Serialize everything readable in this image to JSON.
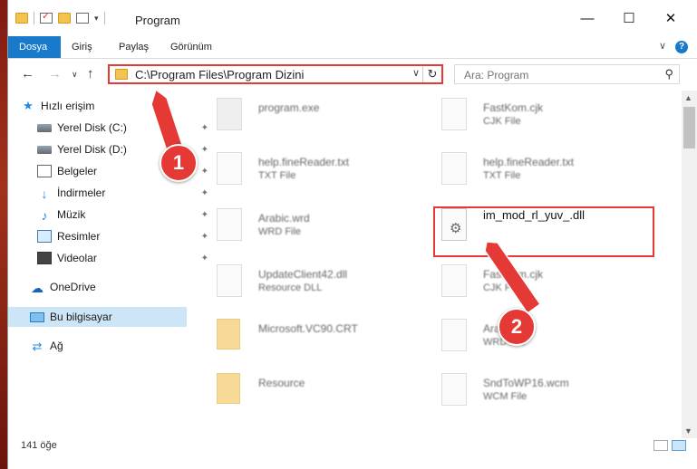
{
  "window": {
    "title": "Program",
    "controls": {
      "minimize": "—",
      "maximize": "☐",
      "close": "✕"
    }
  },
  "ribbon": {
    "tabs": [
      "Dosya",
      "Giriş",
      "Paylaş",
      "Görünüm"
    ],
    "expand": "∨",
    "help": "?"
  },
  "nav": {
    "back": "←",
    "forward": "→",
    "dropdown": "∨",
    "up": "↑",
    "address": "C:\\Program Files\\Program Dizini",
    "address_dropdown": "∨",
    "refresh": "↻",
    "search_placeholder": "Ara: Program",
    "search_icon": "⚲"
  },
  "sidebar": {
    "items": [
      {
        "label": "Hızlı erişim",
        "icon": "star-icon",
        "pinned": false
      },
      {
        "label": "Yerel Disk (C:)",
        "icon": "drive-icon",
        "pinned": true
      },
      {
        "label": "Yerel Disk (D:)",
        "icon": "drive-icon",
        "pinned": true
      },
      {
        "label": "Belgeler",
        "icon": "document-icon",
        "pinned": true
      },
      {
        "label": "İndirmeler",
        "icon": "download-icon",
        "pinned": true
      },
      {
        "label": "Müzik",
        "icon": "music-icon",
        "pinned": true
      },
      {
        "label": "Resimler",
        "icon": "pictures-icon",
        "pinned": true
      },
      {
        "label": "Videolar",
        "icon": "videos-icon",
        "pinned": true
      },
      {
        "label": "OneDrive",
        "icon": "cloud-icon",
        "pinned": false
      },
      {
        "label": "Bu bilgisayar",
        "icon": "computer-icon",
        "pinned": false,
        "selected": true
      },
      {
        "label": "Ağ",
        "icon": "network-icon",
        "pinned": false
      }
    ],
    "pin_glyph": "📌"
  },
  "files": [
    {
      "name": "program.exe",
      "type": "",
      "icon": "exe-icon"
    },
    {
      "name": "FastKom.cjk",
      "type": "CJK File",
      "icon": "file-icon"
    },
    {
      "name": "help.fineReader.txt",
      "type": "TXT File",
      "icon": "file-icon"
    },
    {
      "name": "help.fineReader.txt",
      "type": "TXT File",
      "icon": "file-icon"
    },
    {
      "name": "Arabic.wrd",
      "type": "WRD File",
      "icon": "file-icon"
    },
    {
      "name": "im_mod_rl_yuv_.dll",
      "type": "",
      "icon": "dll-gear-icon",
      "highlighted": true
    },
    {
      "name": "UpdateClient42.dll",
      "type": "Resource DLL",
      "icon": "dll-gear-icon"
    },
    {
      "name": "FastKom.cjk",
      "type": "CJK File",
      "icon": "file-icon"
    },
    {
      "name": "Microsoft.VC90.CRT",
      "type": "",
      "icon": "folder-icon"
    },
    {
      "name": "Arabic.wrd",
      "type": "WRD File",
      "icon": "file-icon"
    },
    {
      "name": "Resource",
      "type": "",
      "icon": "folder-icon"
    },
    {
      "name": "SndToWP16.wcm",
      "type": "WCM File",
      "icon": "file-icon"
    }
  ],
  "status": {
    "count": "141 öğe"
  },
  "annotations": {
    "badge1": "1",
    "badge2": "2"
  },
  "colors": {
    "accent": "#1979ca",
    "highlight": "#e53935",
    "selected_bg": "#cde6f7"
  }
}
